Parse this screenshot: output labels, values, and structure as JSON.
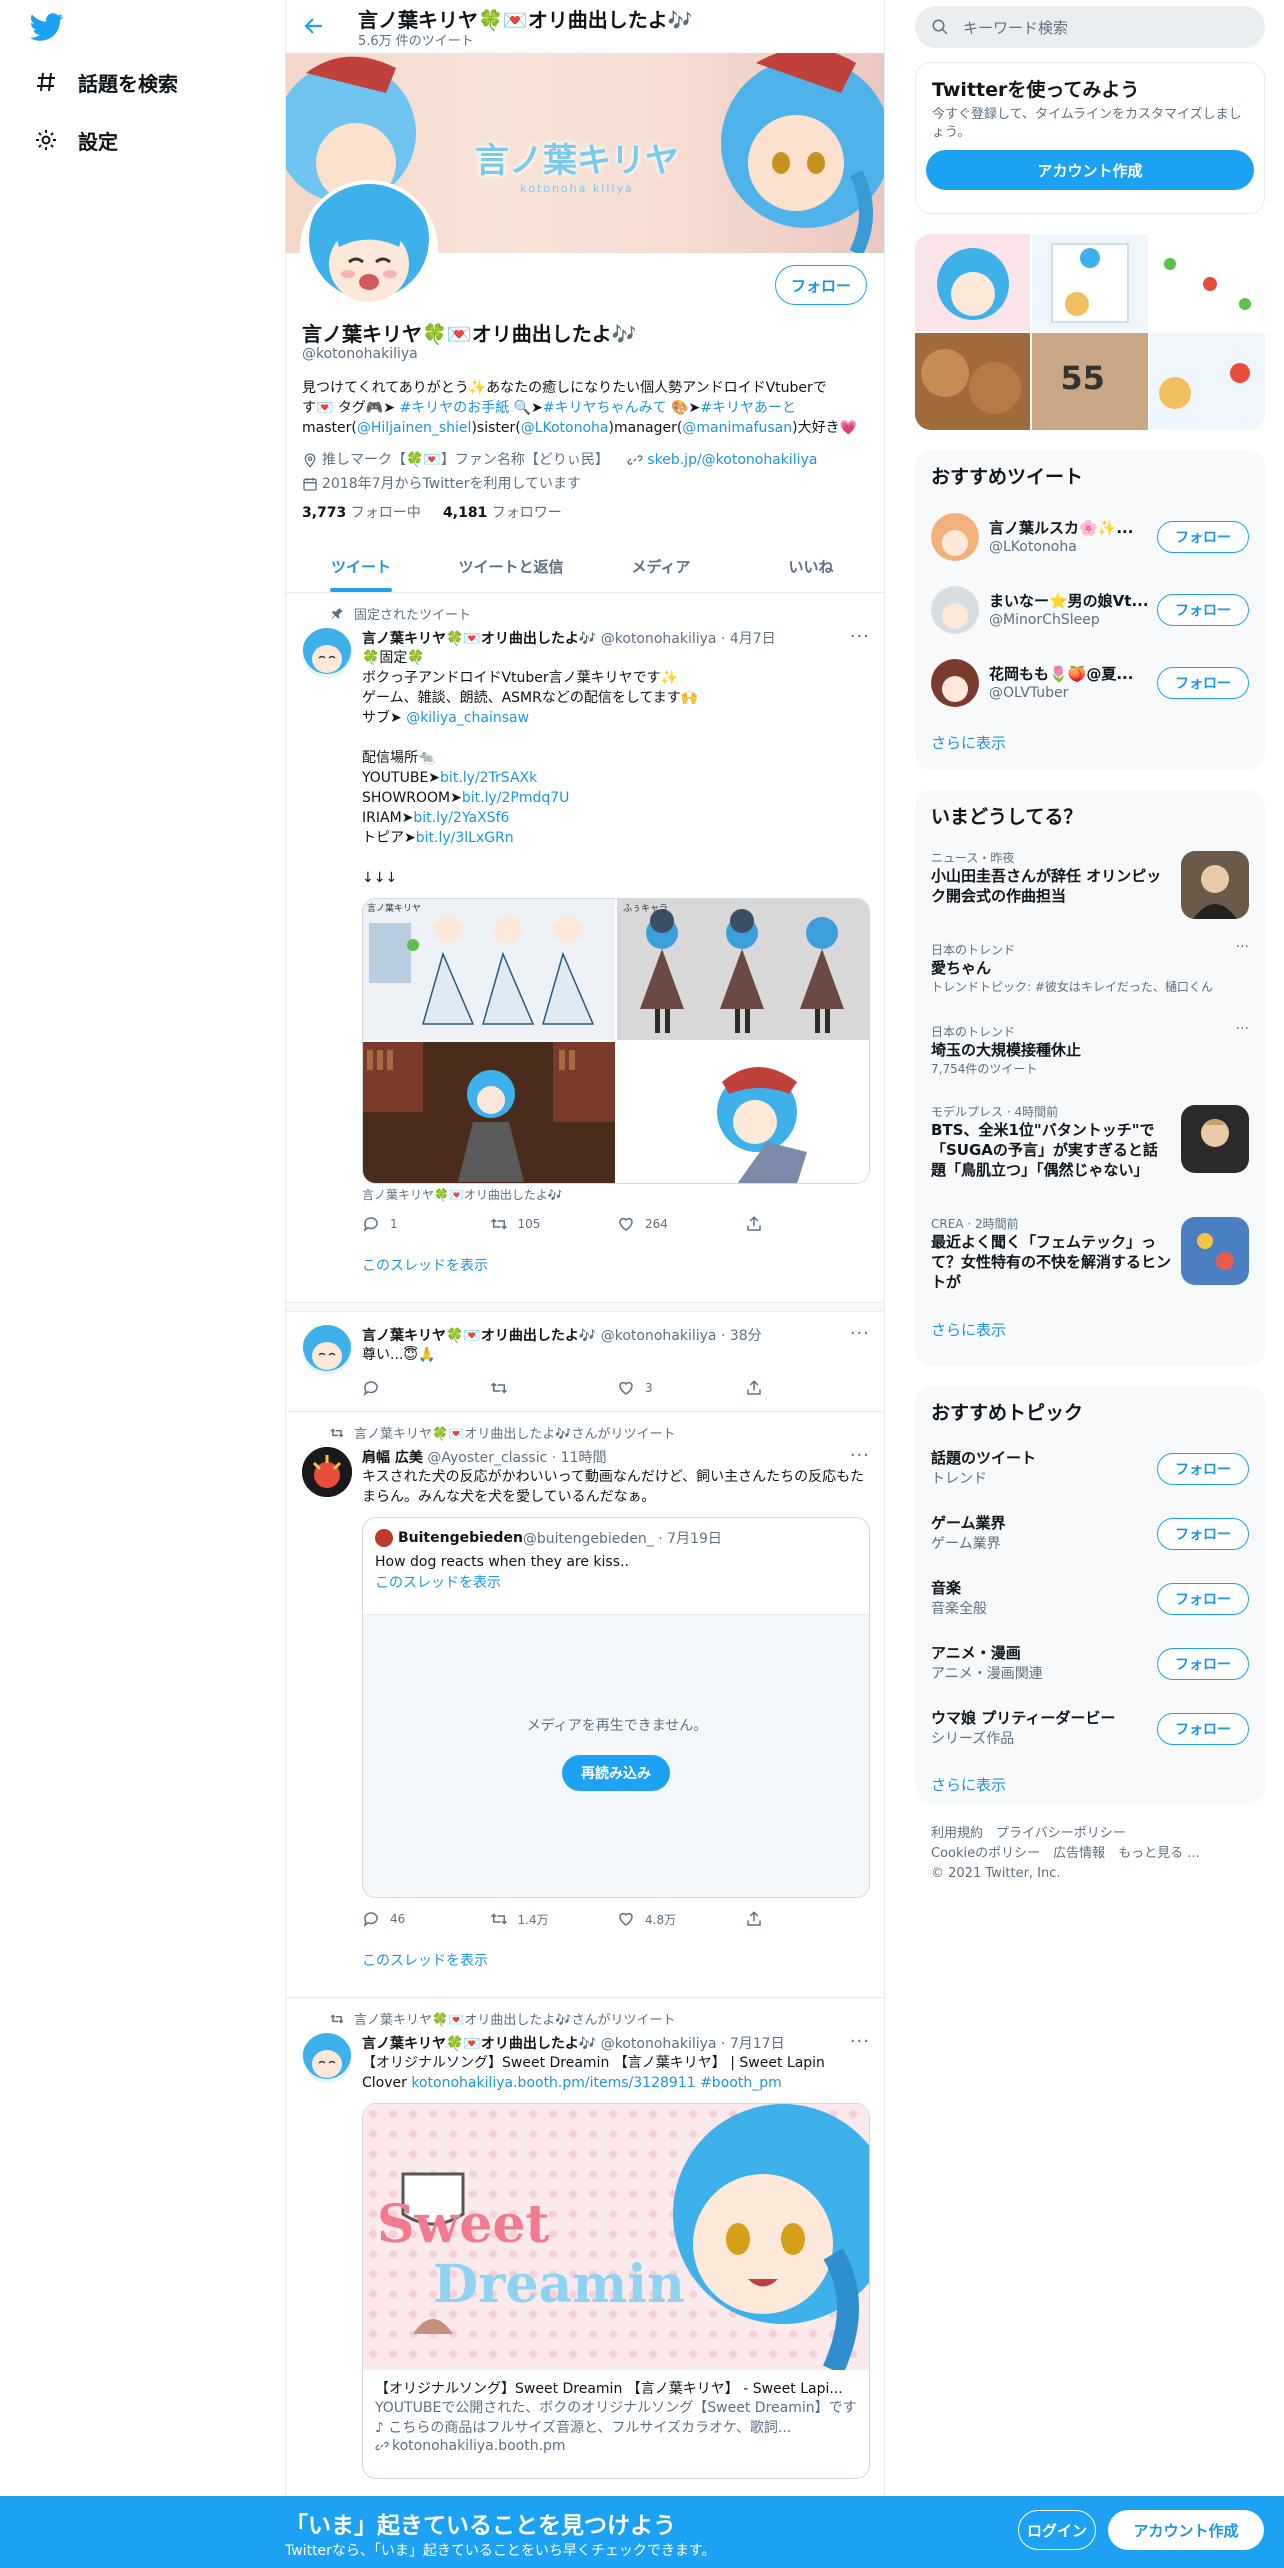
{
  "nav": {
    "explore_label": "話題を検索",
    "settings_label": "設定"
  },
  "topbar": {
    "name": "言ノ葉キリヤ🍀💌オリ曲出したよ🎶",
    "tweet_count": "5.6万 件のツイート"
  },
  "banner": {
    "logo_text": "言ノ葉キリヤ",
    "logo_sub": "kotonoha kiliya"
  },
  "profile": {
    "name": "言ノ葉キリヤ🍀💌オリ曲出したよ🎶",
    "handle": "@kotonohakiliya",
    "follow_label": "フォロー",
    "bio_line1": "見つけてくれてありがとう✨あなたの癒しになりたい個人勢アンドロイドVtuberで",
    "bio_line2a": "す💌 タグ🎮➤ ",
    "bio_tag1": "#キリヤのお手紙",
    "bio_line2b": " 🔍➤",
    "bio_tag2": "#キリヤちゃんみて",
    "bio_line2c": " 🎨➤",
    "bio_tag3": "#キリヤあーと",
    "bio_line3a": "master(",
    "bio_m1": "@Hiljainen_shiel",
    "bio_line3b": ")sister(",
    "bio_m2": "@LKotonoha",
    "bio_line3c": ")manager(",
    "bio_m3": "@manimafusan",
    "bio_line3d": ")大好き💗",
    "location": "推しマーク【🍀💌】ファン名称【どりぃ民】",
    "website": "skeb.jp/@kotonohakiliya",
    "joined": "2018年7月からTwitterを利用しています",
    "following_count": "3,773",
    "following_label": " フォロー中",
    "followers_count": "4,181",
    "followers_label": " フォロワー"
  },
  "tabs": [
    "ツイート",
    "ツイートと返信",
    "メディア",
    "いいね"
  ],
  "tweet1": {
    "pinned_label": "固定されたツイート",
    "name": "言ノ葉キリヤ🍀💌オリ曲出したよ🎶",
    "meta": " @kotonohakiliya · 4月7日",
    "line1": "🍀固定🍀",
    "line2": "ボクっ子アンドロイドVtuber言ノ葉キリヤです✨",
    "line3": "ゲーム、雑談、朗読、ASMRなどの配信をしてます🙌",
    "line4a": "サブ➤ ",
    "sub_link": "@kiliya_chainsaw",
    "line5": "配信場所🐀",
    "yt_label": "YOUTUBE➤",
    "yt_link": "bit.ly/2TrSAXk",
    "sr_label": "SHOWROOM➤",
    "sr_link": "bit.ly/2Pmdq7U",
    "ir_label": "IRIAM➤",
    "ir_link": "bit.ly/2YaXSf6",
    "tp_label": "トピア➤",
    "tp_link": "bit.ly/3lLxGRn",
    "arrows": "↓↓↓",
    "img1_caption": "言ノ葉キリヤ",
    "img2_caption": "ふぅキャラ",
    "media_caption": "言ノ葉キリヤ🍀💌オリ曲出したよ🎶",
    "replies": "1",
    "retweets": "105",
    "likes": "264",
    "thread_label": "このスレッドを表示"
  },
  "tweet2": {
    "name": "言ノ葉キリヤ🍀💌オリ曲出したよ🎶",
    "meta": " @kotonohakiliya · 38分",
    "text": "尊い...😇🙏",
    "replies": "",
    "retweets": "",
    "likes": "3"
  },
  "tweet3": {
    "retweeted_by": "言ノ葉キリヤ🍀💌オリ曲出したよ🎶さんがリツイート",
    "name": "肩幅 広美",
    "meta": " @Ayoster_classic · 11時間",
    "text": "キスされた犬の反応がかわいいって動画なんだけど、飼い主さんたちの反応もたまらん。みんな犬を犬を愛しているんだなぁ。",
    "quote_name": "Buitengebieden",
    "quote_meta": " @buitengebieden_ · 7月19日",
    "quote_text": "How dog reacts when they are kiss..",
    "quote_thread": "このスレッドを表示",
    "media_error": "メディアを再生できません。",
    "reload_label": "再読み込み",
    "replies": "46",
    "retweets": "1.4万",
    "likes": "4.8万",
    "thread_label": "このスレッドを表示"
  },
  "tweet4": {
    "retweeted_by": "言ノ葉キリヤ🍀💌オリ曲出したよ🎶さんがリツイート",
    "name": "言ノ葉キリヤ🍀💌オリ曲出したよ🎶",
    "meta": " @kotonohakiliya · 7月17日",
    "text": "【オリジナルソング】Sweet Dreamin 【言ノ葉キリヤ】 | Sweet Lapin Clover ",
    "link": "kotonohakiliya.booth.pm/items/3128911",
    "hashtag": "#booth_pm",
    "card_art_line1": "Sweet",
    "card_art_line2": "Dreamin",
    "card_title": "【オリジナルソング】Sweet Dreamin 【言ノ葉キリヤ】 - Sweet Lapi...",
    "card_desc": "YOUTUBEで公開された、ボクのオリジナルソング【Sweet Dreamin】です♪ こちらの商品はフルサイズ音源と、フルサイズカラオケ、歌詞...",
    "card_domain": "kotonohakiliya.booth.pm"
  },
  "right": {
    "search_placeholder": "キーワード検索",
    "signup_title": "Twitterを使ってみよう",
    "signup_desc": "今すぐ登録して、タイムラインをカスタマイズしましょう。",
    "signup_button": "アカウント作成",
    "thumb_badge": "55",
    "who_title": "おすすめツイート",
    "who": [
      {
        "name": "言ノ葉ルスカ🌸✨...",
        "handle": "@LKotonoha"
      },
      {
        "name": "まいなー⭐男の娘Vt...",
        "handle": "@MinorChSleep"
      },
      {
        "name": "花岡もも🌷🍑@夏...",
        "handle": "@OLVTuber"
      }
    ],
    "follow_label": "フォロー",
    "show_more": "さらに表示",
    "trends_title": "いまどうしてる？",
    "trends": [
      {
        "ctx": "ニュース・昨夜",
        "title": "小山田圭吾さんが辞任 オリンピック開会式の作曲担当",
        "sub": ""
      },
      {
        "ctx": "日本のトレンド",
        "title": "愛ちゃん",
        "sub": "トレンドトピック: #彼女はキレイだった、樋口くん"
      },
      {
        "ctx": "日本のトレンド",
        "title": "埼玉の大規模接種休止",
        "sub": "7,754件のツイート"
      },
      {
        "ctx": "モデルプレス · 4時間前",
        "title": "BTS、全米1位\"バタントッチ\"で「SUGAの予言」が実すぎると話題「鳥肌立つ」「偶然じゃない」",
        "sub": ""
      },
      {
        "ctx": "CREA · 2時間前",
        "title": "最近よく聞く「フェムテック」って？女性特有の不快を解消するヒントが",
        "sub": ""
      }
    ],
    "topics_title": "おすすめトピック",
    "topics": [
      {
        "title": "話題のツイート",
        "sub": "トレンド"
      },
      {
        "title": "ゲーム業界",
        "sub": "ゲーム業界"
      },
      {
        "title": "音楽",
        "sub": "音楽全般"
      },
      {
        "title": "アニメ・漫画",
        "sub": "アニメ・漫画関連"
      },
      {
        "title": "ウマ娘 プリティーダービー",
        "sub": "シリーズ作品"
      }
    ],
    "footer_line1": "利用規約　プライバシーポリシー",
    "footer_line2": "Cookieのポリシー　広告情報　もっと見る ...",
    "footer_line3": "© 2021 Twitter, Inc."
  },
  "bottom": {
    "title": "「いま」起きていることを見つけよう",
    "subtitle": "Twitterなら、「いま」起きていることをいち早くチェックできます。",
    "login": "ログイン",
    "signup": "アカウント作成"
  },
  "colors": {
    "accent": "#1da1f2",
    "link": "#1b95e0",
    "muted": "#5b7083"
  }
}
